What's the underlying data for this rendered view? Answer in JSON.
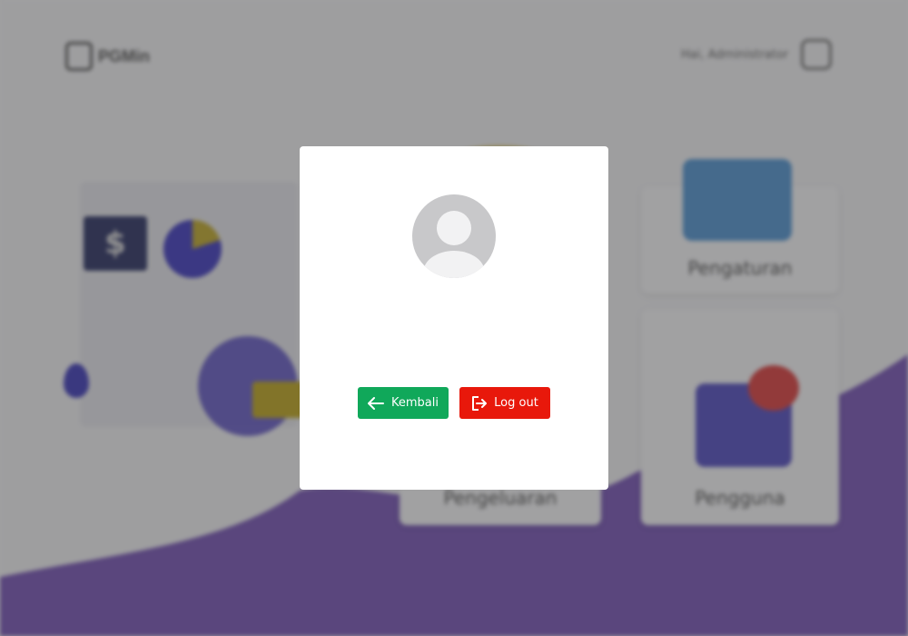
{
  "background": {
    "brand_name": "PGMin",
    "user_name": "Hai, Administrator",
    "cards": [
      {
        "label": "Pengeluaran"
      },
      {
        "label": "Pengguna"
      },
      {
        "label": "Pengaturan"
      }
    ],
    "colors": {
      "wave": "#8a6cc0",
      "page": "#f3f3f5"
    }
  },
  "modal": {
    "avatar_icon": "user-avatar-placeholder",
    "back_button": {
      "label": "Kembali",
      "icon": "arrow-left-icon",
      "color": "#10a85a"
    },
    "logout_button": {
      "label": "Log out",
      "icon": "logout-icon",
      "color": "#e8180b"
    }
  }
}
